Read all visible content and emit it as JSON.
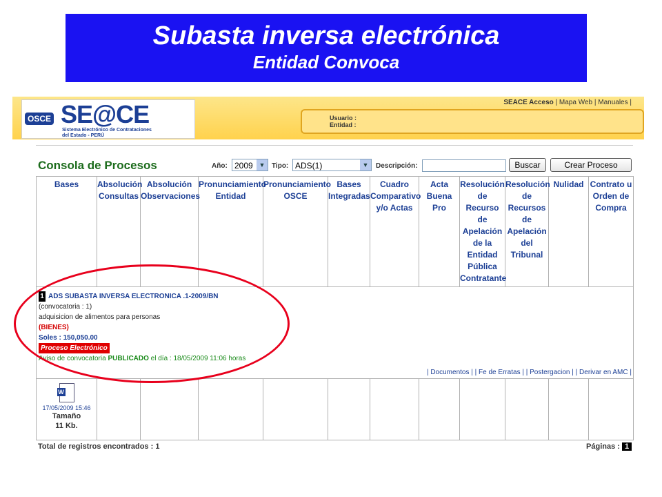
{
  "banner": {
    "title": "Subasta inversa electrónica",
    "subtitle": "Entidad Convoca"
  },
  "header": {
    "logo_osce": "OSCE",
    "logo_seace": "SE@CE",
    "logo_sub_line1": "Sistema Electrónico de Contrataciones",
    "logo_sub_line2": "del Estado - PERÚ",
    "links": [
      "SEACE Acceso",
      "Mapa Web",
      "Manuales"
    ],
    "usuario_label": "Usuario :",
    "entidad_label": "Entidad :"
  },
  "console": {
    "title": "Consola de Procesos",
    "anio_label": "Año:",
    "anio_value": "2009",
    "tipo_label": "Tipo:",
    "tipo_value": "ADS(1)",
    "descripcion_label": "Descripción:",
    "descripcion_value": "",
    "buscar_label": "Buscar",
    "crear_label": "Crear Proceso"
  },
  "columns": [
    "Bases",
    "Absolución Consultas",
    "Absolución Observaciones",
    "Pronunciamiento Entidad",
    "Pronunciamiento OSCE",
    "Bases Integradas",
    "Cuadro Comparativo y/o Actas",
    "Acta Buena Pro",
    "Resolución de Recurso de Apelación de la Entidad Pública Contratante",
    "Resolución de Recursos de Apelación del Tribunal",
    "Nulidad",
    "Contrato u Orden de Compra"
  ],
  "process": {
    "number": "1",
    "name": "ADS SUBASTA INVERSA ELECTRONICA .1-2009/BN",
    "convocatoria": "(convocatoria : 1)",
    "description": "adquisicion de alimentos para personas",
    "category": "(BIENES)",
    "amount": "Soles : 150,050.00",
    "badge": "Proceso Electrónico",
    "aviso_prefix": "Aviso de convocatoria ",
    "aviso_status": "PUBLICADO",
    "aviso_suffix": " el día : 18/05/2009 11:06 horas",
    "links": [
      "Documentos",
      "Fe de Erratas",
      "Postergacion",
      "Derivar en AMC"
    ]
  },
  "document": {
    "icon": "word-doc-icon",
    "date": "17/05/2009 15:46",
    "size_label": "Tamaño",
    "size_value": "11 Kb."
  },
  "footer": {
    "total_label": "Total de registros encontrados : 1",
    "pages_label": "Páginas :",
    "page": "1"
  },
  "colors": {
    "banner": "#1a12f2",
    "header_yellow": "#ffd24d",
    "title_green": "#1b6b1b",
    "link_blue": "#1c3f95",
    "annotation_red": "#e8001c"
  }
}
